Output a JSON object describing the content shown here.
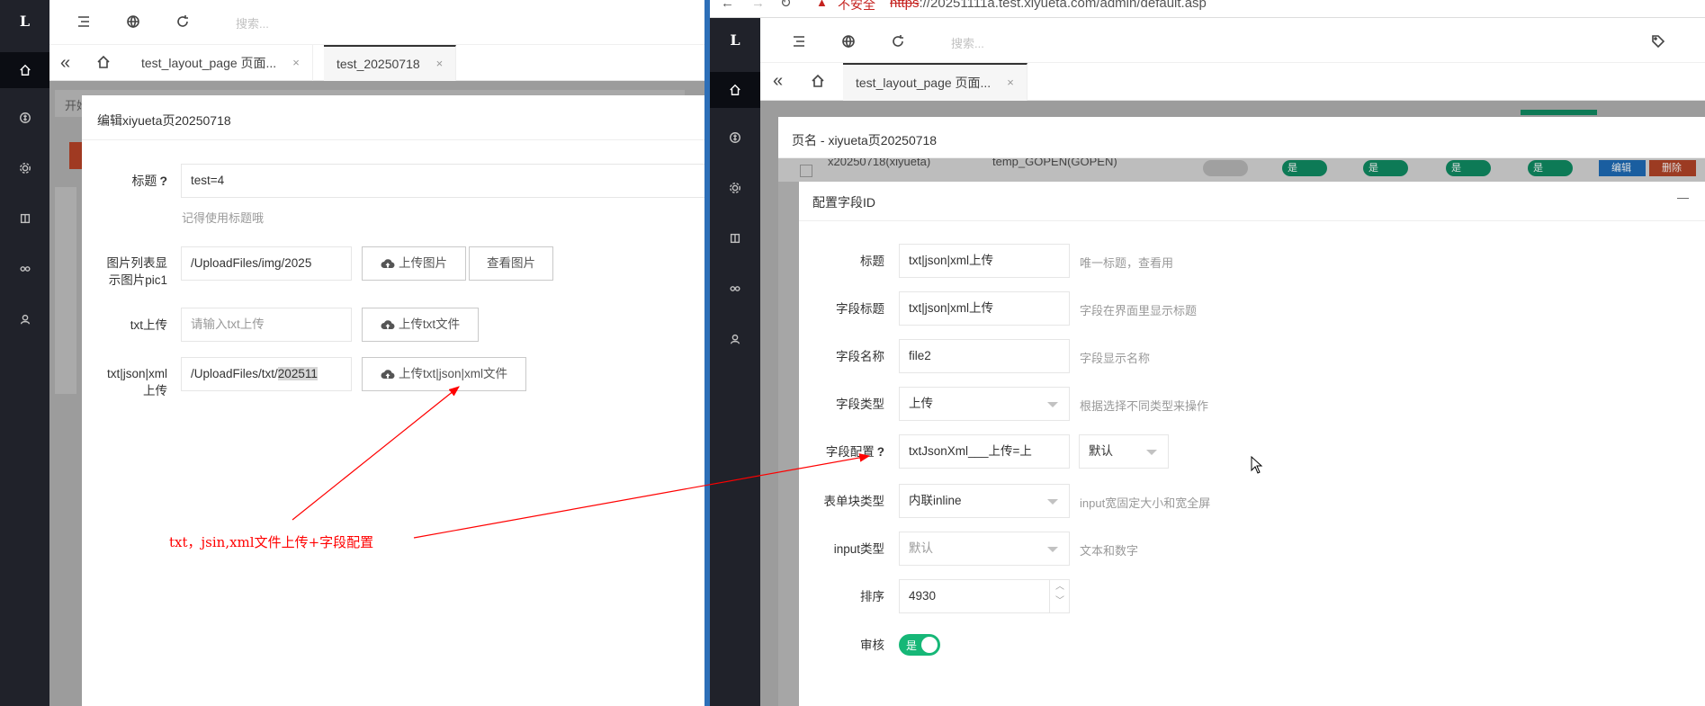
{
  "left": {
    "logo": "L",
    "toolbar": {
      "search_placeholder": "搜索..."
    },
    "tabs": [
      {
        "label": "test_layout_page 页面...",
        "close": "×"
      },
      {
        "label": "test_20250718",
        "close": "×"
      }
    ],
    "bg_label": "开始",
    "dialog": {
      "title": "编辑xiyueta页20250718",
      "fields": {
        "title_label": "标题",
        "title_help": "?",
        "title_value": "test=4",
        "title_hint": "记得使用标题哦",
        "image_label": "图片列表显示图片pic1",
        "image_value": "/UploadFiles/img/2025",
        "upload_image": "上传图片",
        "view_image": "查看图片",
        "txt_label": "txt上传",
        "txt_placeholder": "请输入txt上传",
        "upload_txt": "上传txt文件",
        "multi_label": "txt|json|xml上传",
        "multi_value_plain": "/UploadFiles/txt/",
        "multi_value_selected": "202511",
        "upload_multi": "上传txt|json|xml文件"
      }
    },
    "annotation": "txt，jsin,xml文件上传+字段配置",
    "annotation_color": "#ff0000"
  },
  "right": {
    "browser": {
      "insecure": "不安全",
      "url_scheme": "https",
      "url_rest": "://20251111a.test.xiyueta.com/admin/default.asp"
    },
    "logo": "L",
    "toolbar": {
      "search_placeholder": "搜索..."
    },
    "tabs": [
      {
        "label": "test_layout_page 页面...",
        "close": "×"
      }
    ],
    "bg_row": {
      "text1": "x20250718(xiyueta)",
      "text2": "temp_GOPEN(GOPEN)",
      "switch_text": "是",
      "edit": "编辑",
      "delete": "删除"
    },
    "outer_dialog": {
      "title": "页名 - xiyueta页20250718"
    },
    "dialog": {
      "title": "配置字段ID",
      "min_button": "—",
      "fields": [
        {
          "label": "标题",
          "value": "txt|json|xml上传",
          "hint": "唯一标题，查看用"
        },
        {
          "label": "字段标题",
          "value": "txt|json|xml上传",
          "hint": "字段在界面里显示标题"
        },
        {
          "label": "字段名称",
          "value": "file2",
          "hint": "字段显示名称"
        },
        {
          "label": "字段类型",
          "value": "上传",
          "hint": "根据选择不同类型来操作"
        },
        {
          "label": "字段配置",
          "help": "?",
          "value": "txtJsonXml___上传=上",
          "select": "默认"
        },
        {
          "label": "表单块类型",
          "value": "内联inline",
          "hint": "input宽固定大小和宽全屏"
        },
        {
          "label": "input类型",
          "value": "默认",
          "hint": "文本和数字"
        },
        {
          "label": "排序",
          "value": "4930"
        },
        {
          "label": "审核",
          "switch": "是"
        }
      ]
    },
    "accent_green": "#16b777"
  }
}
